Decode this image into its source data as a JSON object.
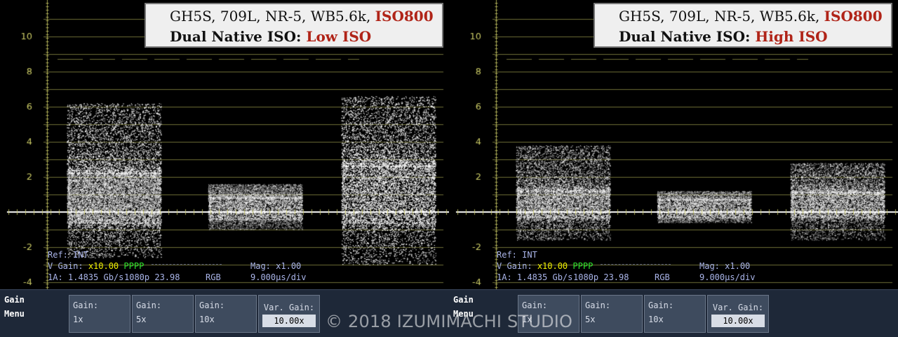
{
  "colors": {
    "graticule": "#c8c864",
    "signal": "#ffffff",
    "caption_red": "#b02418",
    "menu_bg": "#1e2838"
  },
  "scope_axis": {
    "tick_labels": [
      "10",
      "8",
      "6",
      "4",
      "2",
      "-2",
      "-4"
    ]
  },
  "panels": [
    {
      "id": "left",
      "caption_line1": "GH5S, 709L, NR-5, WB5.6k,",
      "caption_iso": "ISO800",
      "caption_line2": "Dual Native ISO:",
      "caption_mode": "Low ISO",
      "ref": "Ref: INT",
      "vgain_label": "V Gain:",
      "vgain_value": "x10.00",
      "vgain_flags": "PPPP",
      "mag_label": "Mag:",
      "mag_value": "x1.00",
      "link": "1A: 1.4835 Gb/s",
      "format": "1080p 23.98",
      "color_space": "RGB",
      "timebase": "9.000µs/div",
      "noise_bars": [
        {
          "start_div": 0.6,
          "end_div": 3.0,
          "spread_top": 6.2,
          "bright_top": 2.2,
          "bright_bottom": -0.6,
          "spread_bottom": -2.6
        },
        {
          "start_div": 4.2,
          "end_div": 6.6,
          "spread_top": 1.6,
          "bright_top": 0.8,
          "bright_bottom": -0.4,
          "spread_bottom": -1.0
        },
        {
          "start_div": 7.6,
          "end_div": 10.0,
          "spread_top": 6.6,
          "bright_top": 2.6,
          "bright_bottom": -0.6,
          "spread_bottom": -3.0
        }
      ]
    },
    {
      "id": "right",
      "caption_line1": "GH5S, 709L, NR-5, WB5.6k,",
      "caption_iso": "ISO800",
      "caption_line2": "Dual Native ISO:",
      "caption_mode": "High ISO",
      "ref": "Ref: INT",
      "vgain_label": "V Gain:",
      "vgain_value": "x10.00",
      "vgain_flags": "PPPP",
      "mag_label": "Mag:",
      "mag_value": "x1.00",
      "link": "1A: 1.4835 Gb/s",
      "format": "1080p 23.98",
      "color_space": "RGB",
      "timebase": "9.000µs/div",
      "noise_bars": [
        {
          "start_div": 0.6,
          "end_div": 3.0,
          "spread_top": 3.8,
          "bright_top": 1.2,
          "bright_bottom": -0.3,
          "spread_bottom": -1.6
        },
        {
          "start_div": 4.2,
          "end_div": 6.6,
          "spread_top": 1.2,
          "bright_top": 0.7,
          "bright_bottom": -0.3,
          "spread_bottom": -0.6
        },
        {
          "start_div": 7.6,
          "end_div": 10.0,
          "spread_top": 2.8,
          "bright_top": 1.1,
          "bright_bottom": -0.3,
          "spread_bottom": -1.6
        }
      ]
    }
  ],
  "menu": {
    "title_line1": "Gain",
    "title_line2": "Menu",
    "buttons": [
      {
        "label": "Gain:",
        "value": "1x"
      },
      {
        "label": "Gain:",
        "value": "5x"
      },
      {
        "label": "Gain:",
        "value": "10x"
      }
    ],
    "var_gain_label": "Var. Gain:",
    "var_gain_value": "10.00x"
  },
  "watermark": "© 2018 IZUMIMACHI STUDIO"
}
